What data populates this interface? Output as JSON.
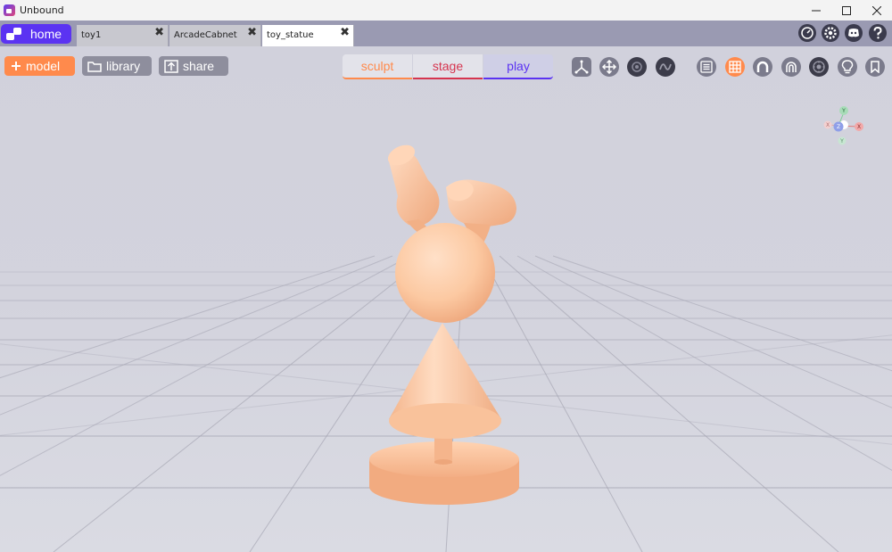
{
  "window": {
    "title": "Unbound"
  },
  "tabs": {
    "home_label": "home",
    "items": [
      {
        "label": "toy1"
      },
      {
        "label": "ArcadeCabnet"
      },
      {
        "label": "toy_statue"
      }
    ],
    "close_glyph": "✖"
  },
  "toolbar": {
    "model_label": "model",
    "library_label": "library",
    "share_label": "share",
    "modes": [
      "sculpt",
      "stage",
      "play"
    ]
  },
  "gizmo": {
    "y": "Y",
    "x": "X",
    "z": "Z",
    "neg_y": "Y",
    "neg_x": "X"
  },
  "colors": {
    "accent_purple": "#5b33f2",
    "accent_orange": "#ff8a4c",
    "stage_red": "#d6354f",
    "model_fill": "#fcc9a2"
  },
  "icons": {
    "tray": [
      "speedometer-icon",
      "gear-icon",
      "discord-icon",
      "help-icon"
    ],
    "tools_left": [
      "axis-transform-icon",
      "move-icon",
      "eye-icon",
      "sine-wave-icon"
    ],
    "tools_right": [
      "list-icon",
      "grid-icon",
      "magnet-icon",
      "magnet-outline-icon",
      "camera-lens-icon",
      "lightbulb-icon",
      "bookmark-icon"
    ]
  }
}
